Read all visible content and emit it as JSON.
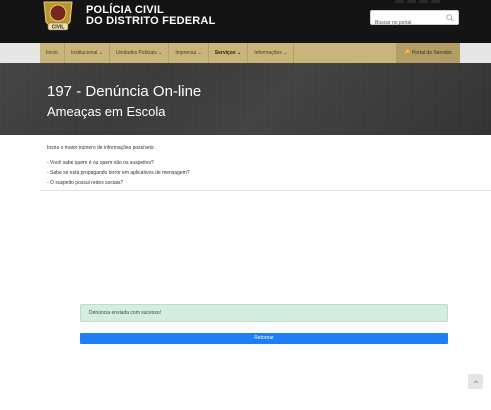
{
  "header": {
    "brand_line1": "POLÍCIA CIVIL",
    "brand_line2": "DO DISTRITO FEDERAL",
    "badge_text": "CIVIL",
    "search_placeholder": "Buscar no portal"
  },
  "nav": {
    "items": [
      {
        "label": "Início"
      },
      {
        "label": "Institucional ⌄"
      },
      {
        "label": "Unidades Policiais ⌄"
      },
      {
        "label": "Imprensa ⌄"
      },
      {
        "label": "Serviços ⌄"
      },
      {
        "label": "Informações ⌄"
      }
    ],
    "portal_label": "Portal do Servidor"
  },
  "banner": {
    "title": "197 - Denúncia On-line",
    "subtitle": "Ameaças em Escola"
  },
  "content": {
    "intro": "Insira o maior número de informações possíveis:",
    "questions": [
      "- Você sabe quem é ou quem são os suspeitos?",
      "- Sabe se está propagando terror em aplicativos de mensagem?",
      "- O suspeito possui redes sociais?"
    ]
  },
  "alert": {
    "message": "Denúncia enviada com sucesso!"
  },
  "actions": {
    "return_label": "Retornar"
  },
  "colors": {
    "header_bg": "#141414",
    "nav_bg": "#c9b47a",
    "alert_bg": "#d4ece1",
    "button_bg": "#1e7ef7"
  }
}
